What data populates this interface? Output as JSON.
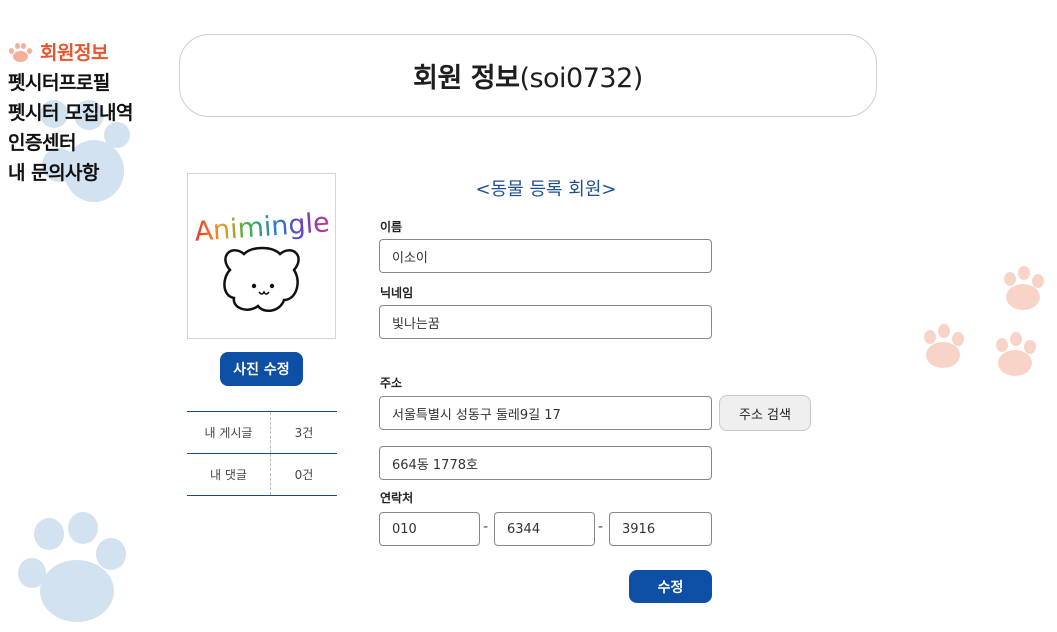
{
  "sidebar": {
    "items": [
      {
        "label": "회원정보",
        "active": true
      },
      {
        "label": "펫시터프로필"
      },
      {
        "label": "펫시터 모집내역"
      },
      {
        "label": "인증센터"
      },
      {
        "label": "내 문의사항"
      }
    ]
  },
  "header": {
    "title": "회원 정보",
    "user_id": "(soi0732)"
  },
  "profile": {
    "logo_text": "Animingle",
    "photo_button": "사진 수정"
  },
  "stats": [
    {
      "label": "내 게시글",
      "value": "3건"
    },
    {
      "label": "내 댓글",
      "value": "0건"
    }
  ],
  "form": {
    "subtitle": "<동물 등록 회원>",
    "name_label": "이름",
    "name_value": "이소이",
    "nickname_label": "닉네임",
    "nickname_value": "빛나는꿈",
    "address_label": "주소",
    "address1_value": "서울특별시 성동구 둘레9길 17",
    "address_search_button": "주소 검색",
    "address2_value": "664동 1778호",
    "phone_label": "연락처",
    "phone1": "010",
    "phone2": "6344",
    "phone3": "3916",
    "phone_sep": "-",
    "submit_button": "수정"
  },
  "colors": {
    "accent": "#0d4fa4",
    "active_menu": "#e8552d",
    "paw_blue": "#d3e2f1",
    "paw_pink": "#f8d4c8"
  }
}
